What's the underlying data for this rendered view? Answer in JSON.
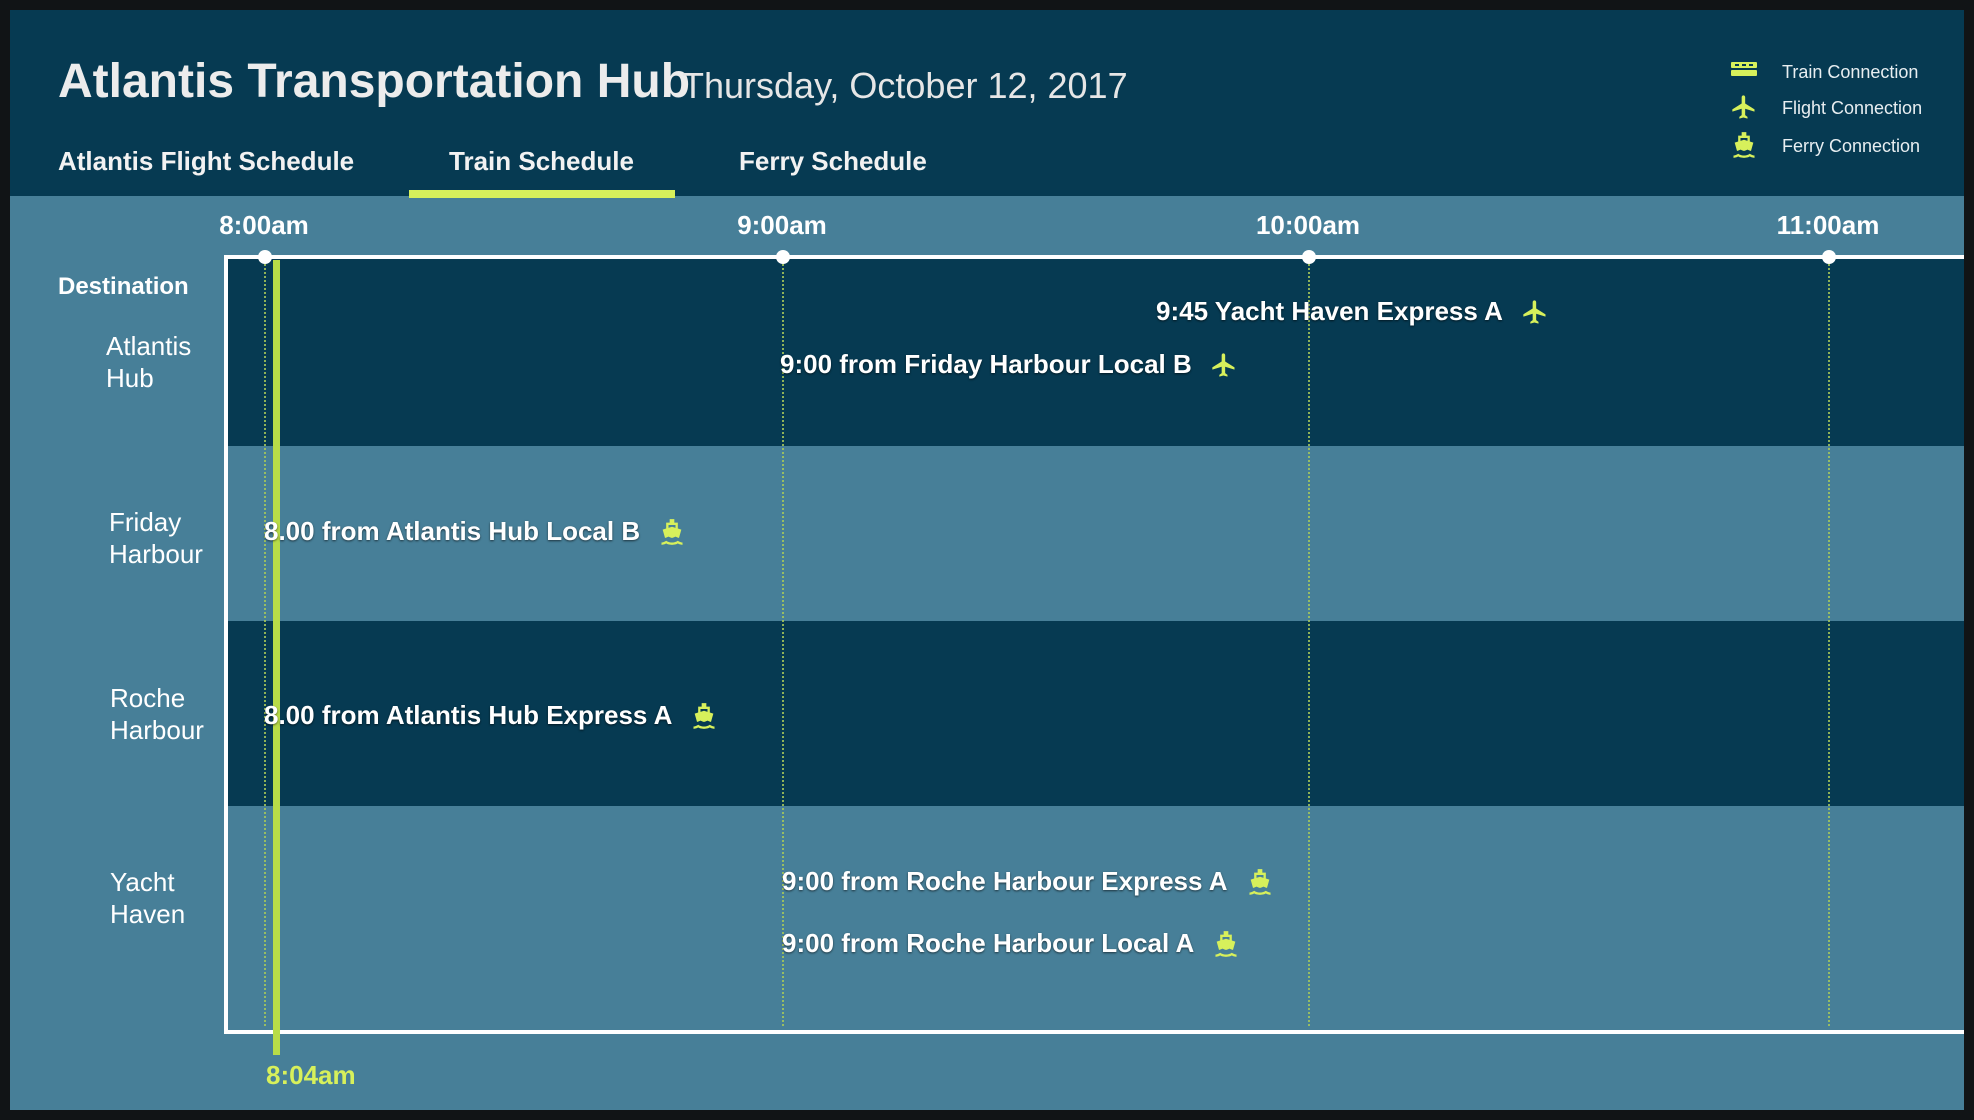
{
  "header": {
    "title": "Atlantis Transportation Hub",
    "date": "Thursday, October 12, 2017"
  },
  "tabs": [
    {
      "label": "Atlantis Flight Schedule",
      "active": false
    },
    {
      "label": "Train Schedule",
      "active": true
    },
    {
      "label": "Ferry Schedule",
      "active": false
    }
  ],
  "legend": [
    {
      "label": "Train Connection",
      "icon": "train-icon"
    },
    {
      "label": "Flight Connection",
      "icon": "plane-icon"
    },
    {
      "label": "Ferry Connection",
      "icon": "ferry-icon"
    }
  ],
  "timeline": {
    "times": [
      "8:00am",
      "9:00am",
      "10:00am",
      "11:00am"
    ],
    "current_time": "8:04am"
  },
  "destination_heading": "Destination",
  "destinations": [
    {
      "name": "Atlantis\nHub",
      "events": [
        {
          "text": "9:45 Yacht Haven Express A",
          "icon": "plane-icon"
        },
        {
          "text": "9:00 from Friday Harbour Local B",
          "icon": "plane-icon"
        }
      ]
    },
    {
      "name": "Friday\nHarbour",
      "events": [
        {
          "text": "8.00 from Atlantis Hub Local B",
          "icon": "ferry-icon"
        }
      ]
    },
    {
      "name": "Roche\nHarbour",
      "events": [
        {
          "text": "8.00 from Atlantis Hub Express A",
          "icon": "ferry-icon"
        }
      ]
    },
    {
      "name": "Yacht\nHaven",
      "events": [
        {
          "text": "9:00 from Roche Harbour Express A",
          "icon": "ferry-icon"
        },
        {
          "text": "9:00 from Roche Harbour Local  A",
          "icon": "ferry-icon"
        }
      ]
    }
  ],
  "colors": {
    "header_bg": "#063a52",
    "body_bg": "#477f98",
    "accent": "#d7f05b",
    "now_line": "#b8dc48"
  }
}
